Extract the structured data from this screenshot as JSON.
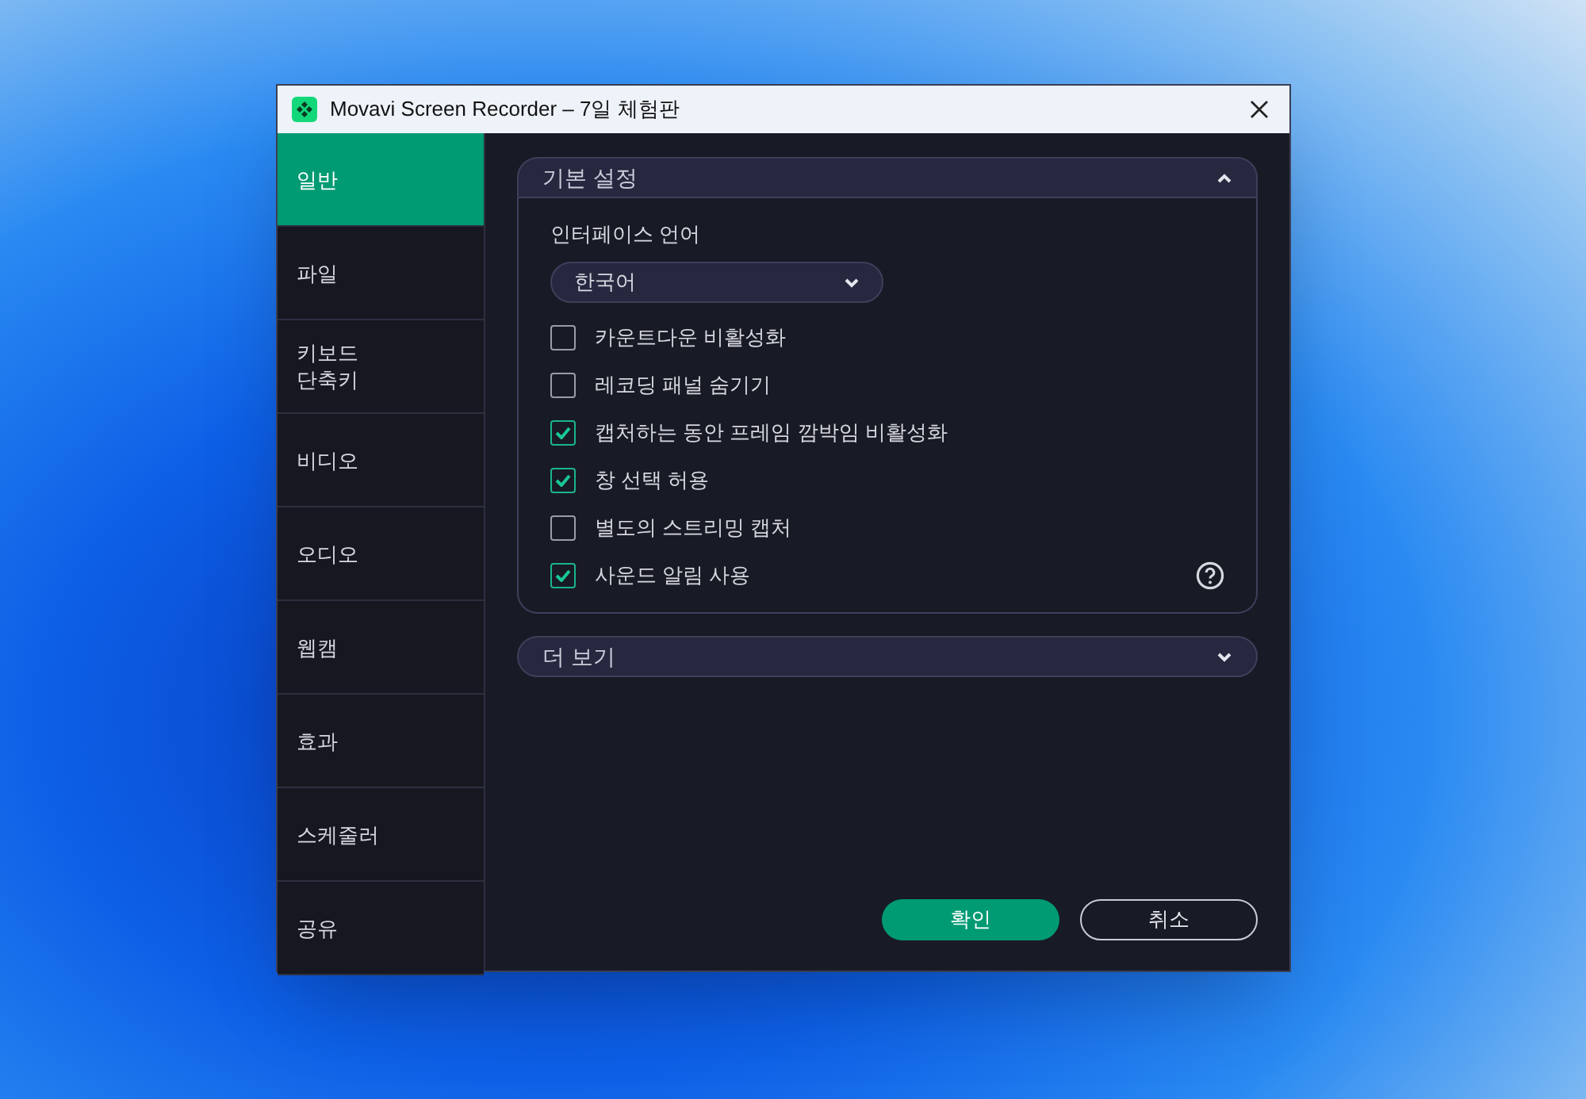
{
  "window": {
    "title": "Movavi Screen Recorder – 7일 체험판"
  },
  "sidebar": {
    "items": [
      {
        "label": "일반",
        "selected": true
      },
      {
        "label": "파일",
        "selected": false
      },
      {
        "label": "키보드\n단축키",
        "selected": false
      },
      {
        "label": "비디오",
        "selected": false
      },
      {
        "label": "오디오",
        "selected": false
      },
      {
        "label": "웹캠",
        "selected": false
      },
      {
        "label": "효과",
        "selected": false
      },
      {
        "label": "스케줄러",
        "selected": false
      },
      {
        "label": "공유",
        "selected": false
      }
    ]
  },
  "sections": [
    {
      "title": "기본 설정",
      "expanded": true,
      "language_label": "인터페이스 언어",
      "language_value": "한국어",
      "options": [
        {
          "label": "카운트다운 비활성화",
          "checked": false,
          "help": false
        },
        {
          "label": "레코딩 패널 숨기기",
          "checked": false,
          "help": false
        },
        {
          "label": "캡처하는 동안 프레임 깜박임 비활성화",
          "checked": true,
          "help": false
        },
        {
          "label": "창 선택 허용",
          "checked": true,
          "help": false
        },
        {
          "label": "별도의 스트리밍 캡처",
          "checked": false,
          "help": false
        },
        {
          "label": "사운드 알림 사용",
          "checked": true,
          "help": true
        }
      ]
    },
    {
      "title": "더 보기",
      "expanded": false
    }
  ],
  "buttons": [
    {
      "label": "확인",
      "kind": "primary"
    },
    {
      "label": "취소",
      "kind": "secondary"
    }
  ]
}
